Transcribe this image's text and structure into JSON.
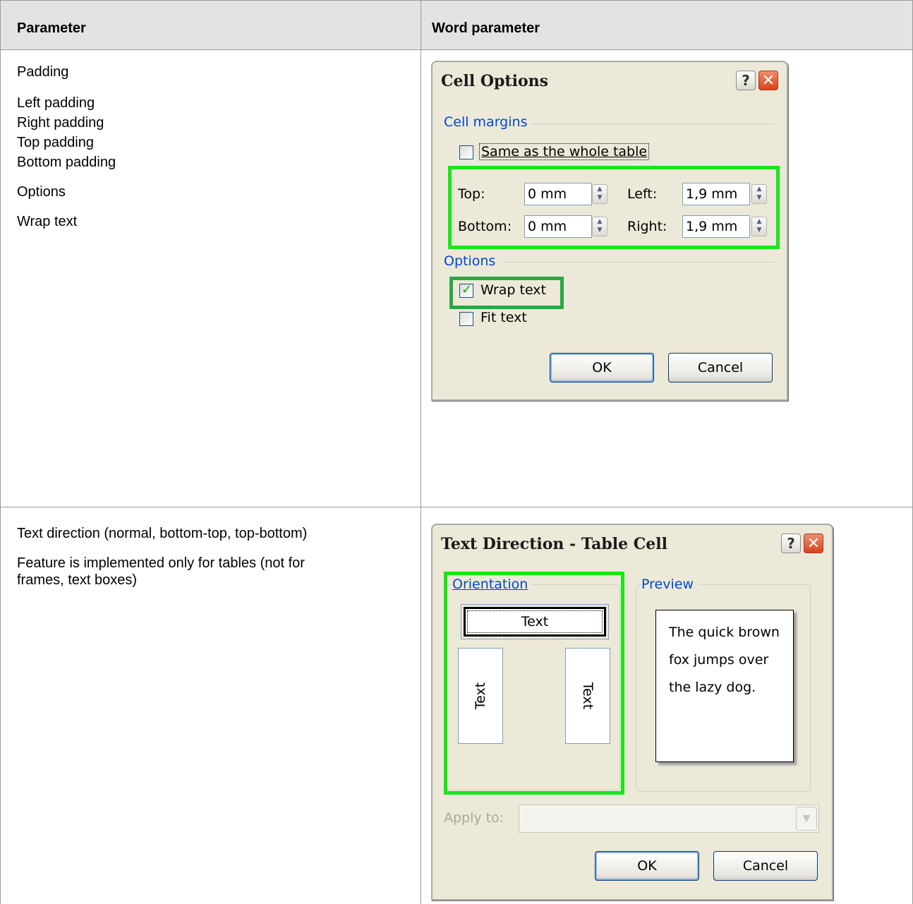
{
  "table": {
    "headers": {
      "parameter": "Parameter",
      "word_parameter": "Word parameter"
    },
    "row1": {
      "lines_group1": [
        "Padding"
      ],
      "lines_group2": [
        "Left padding",
        "Right padding",
        "Top padding",
        "Bottom padding"
      ],
      "lines_group3": [
        "Options"
      ],
      "lines_group4": [
        "Wrap text"
      ]
    },
    "row2": {
      "line1": "Text direction (normal, bottom-top, top-bottom)",
      "line2": "Feature is implemented only for tables (not for",
      "line3": "frames, text boxes)"
    }
  },
  "cell_options": {
    "title": "Cell Options",
    "help_glyph": "?",
    "close_glyph": "✕",
    "group_margins": "Cell margins",
    "same_as_table": "Same as the whole table",
    "same_as_table_checked": false,
    "top_label": "Top:",
    "top_value": "0 mm",
    "left_label": "Left:",
    "left_value": "1,9 mm",
    "bottom_label": "Bottom:",
    "bottom_value": "0 mm",
    "right_label": "Right:",
    "right_value": "1,9 mm",
    "group_options": "Options",
    "wrap_text": "Wrap text",
    "wrap_text_checked": true,
    "fit_text": "Fit text",
    "fit_text_checked": false,
    "ok": "OK",
    "cancel": "Cancel"
  },
  "text_direction": {
    "title": "Text Direction - Table Cell",
    "help_glyph": "?",
    "close_glyph": "✕",
    "group_orientation": "Orientation",
    "group_preview": "Preview",
    "tile_horizontal": "Text",
    "tile_vertical_left": "Text",
    "tile_vertical_right": "Text",
    "preview_lines": [
      "The quick brown",
      "fox jumps over",
      "the lazy dog."
    ],
    "apply_to_label": "Apply to:",
    "apply_to_value": "",
    "ok": "OK",
    "cancel": "Cancel"
  },
  "colors": {
    "highlight_bright": "#19e619",
    "highlight_dark": "#2aa744",
    "xp_group_label": "#0046d5",
    "dialog_face": "#ece9d8"
  }
}
